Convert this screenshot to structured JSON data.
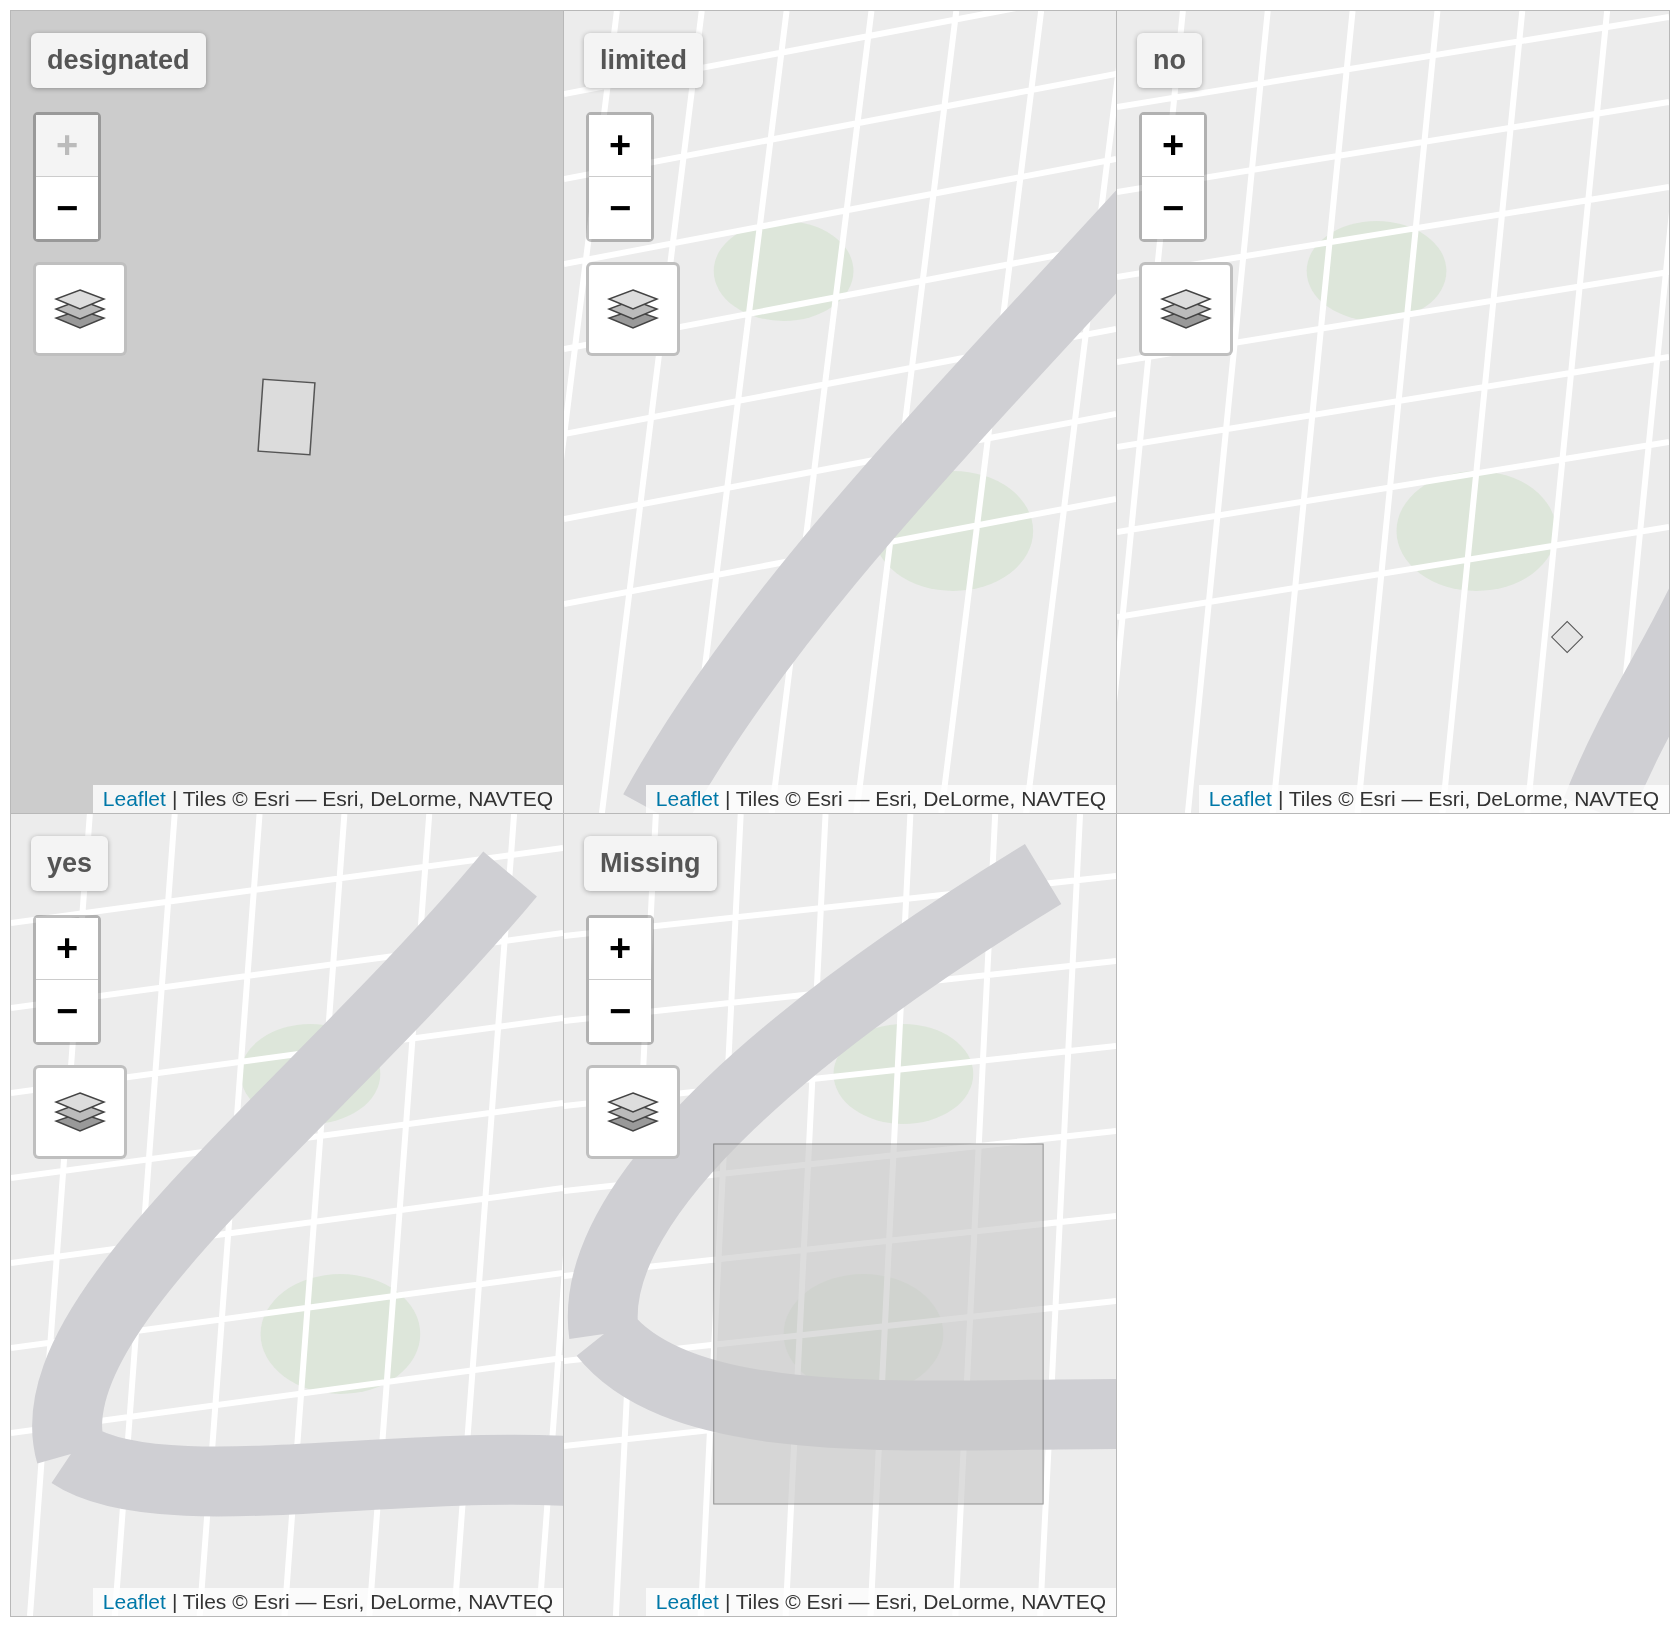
{
  "panels": [
    {
      "title": "designated",
      "zoom_in": {
        "label": "+",
        "disabled": true
      },
      "zoom_out": {
        "label": "−",
        "disabled": false
      },
      "attribution": {
        "link": "Leaflet",
        "text": "| Tiles © Esri — Esri, DeLorme, NAVTEQ"
      }
    },
    {
      "title": "limited",
      "zoom_in": {
        "label": "+",
        "disabled": false
      },
      "zoom_out": {
        "label": "−",
        "disabled": false
      },
      "attribution": {
        "link": "Leaflet",
        "text": "| Tiles © Esri — Esri, DeLorme, NAVTEQ"
      }
    },
    {
      "title": "no",
      "zoom_in": {
        "label": "+",
        "disabled": false
      },
      "zoom_out": {
        "label": "−",
        "disabled": false
      },
      "attribution": {
        "link": "Leaflet",
        "text": "| Tiles © Esri — Esri, DeLorme, NAVTEQ"
      }
    },
    {
      "title": "yes",
      "zoom_in": {
        "label": "+",
        "disabled": false
      },
      "zoom_out": {
        "label": "−",
        "disabled": false
      },
      "attribution": {
        "link": "Leaflet",
        "text": "| Tiles © Esri — Esri, DeLorme, NAVTEQ"
      }
    },
    {
      "title": "Missing",
      "zoom_in": {
        "label": "+",
        "disabled": false
      },
      "zoom_out": {
        "label": "−",
        "disabled": false
      },
      "attribution": {
        "link": "Leaflet",
        "text": "| Tiles © Esri — Esri, DeLorme, NAVTEQ"
      }
    }
  ]
}
